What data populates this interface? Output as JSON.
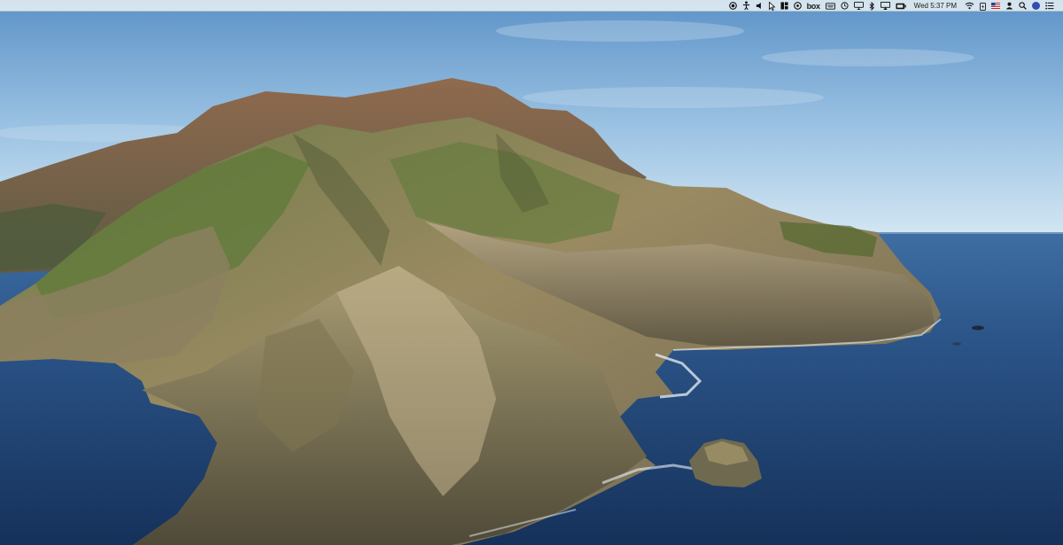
{
  "menubar": {
    "clock": "Wed 5:37 PM",
    "box_label": "box",
    "status_icons": [
      "record-icon",
      "accessibility-icon",
      "volume-icon",
      "cursor-icon",
      "grid-icon",
      "settings-circle-icon",
      "box-icon",
      "keyboard-icon",
      "time-machine-icon",
      "display-icon",
      "bluetooth-icon",
      "airplay-icon",
      "battery-icon",
      "wifi-icon",
      "battery-charging-icon",
      "flag-us-icon",
      "user-icon",
      "spotlight-search-icon",
      "siri-icon",
      "notification-center-icon"
    ]
  },
  "colors": {
    "sky_top": "#5f97cc",
    "sky_bottom": "#cfe3f1",
    "ocean": "#1e3f6b",
    "menubar": "#dee9f1"
  }
}
